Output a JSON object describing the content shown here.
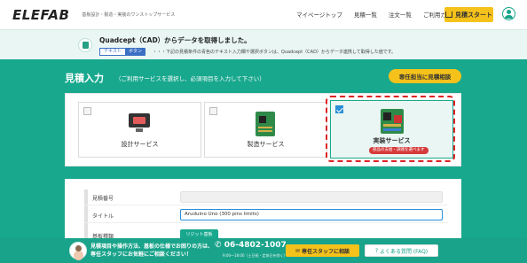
{
  "header": {
    "logo": "ELEFAB",
    "tagline": "基板設計・製造・実装のワンストップサービス",
    "nav": [
      "マイページトップ",
      "見積一覧",
      "注文一覧",
      "ご利用ガイド"
    ],
    "estimate_button": "見積スタート"
  },
  "banner": {
    "title": "Quadcept（CAD）からデータを取得しました。",
    "tag_text": "テキスト",
    "tag_button": "ボタン",
    "note": "・・・下記の見積条件の青色のテキスト入力欄や選択ボタンは、Quadcept（CAD）からデータ連携して取得した値です。"
  },
  "main": {
    "title": "見積入力",
    "subtitle": "（ご利用サービスを選択し、必須項目を入力して下さい）",
    "consult_button": "専任担当に見積相談",
    "services": [
      {
        "label": "設計サービス",
        "checked": false
      },
      {
        "label": "製造サービス",
        "checked": false
      },
      {
        "label": "実装サービス",
        "checked": true,
        "note": "部品の支給・調達を選べます"
      }
    ]
  },
  "form": {
    "rows": [
      {
        "label": "見積番号",
        "value": ""
      },
      {
        "label": "タイトル",
        "value": "Aruduino Uno (300 pins limits)"
      },
      {
        "label": "基板種類",
        "value": "リジット基板"
      }
    ]
  },
  "footer": {
    "message_line1": "見積項目や操作方法、基板の仕様でお困りの方は、",
    "message_line2": "専任スタッフにお気軽にご相談ください！",
    "phone": "06-4802-1007",
    "hours": "9:00～18:00（土日祝・定休日を除く）",
    "consult_button": "専任スタッフに相談",
    "faq_button": "よくある質問 (FAQ)"
  },
  "colors": {
    "teal": "#18a88e",
    "yellow": "#f5c21b",
    "blue": "#2a8fd6",
    "red": "#d22222"
  }
}
